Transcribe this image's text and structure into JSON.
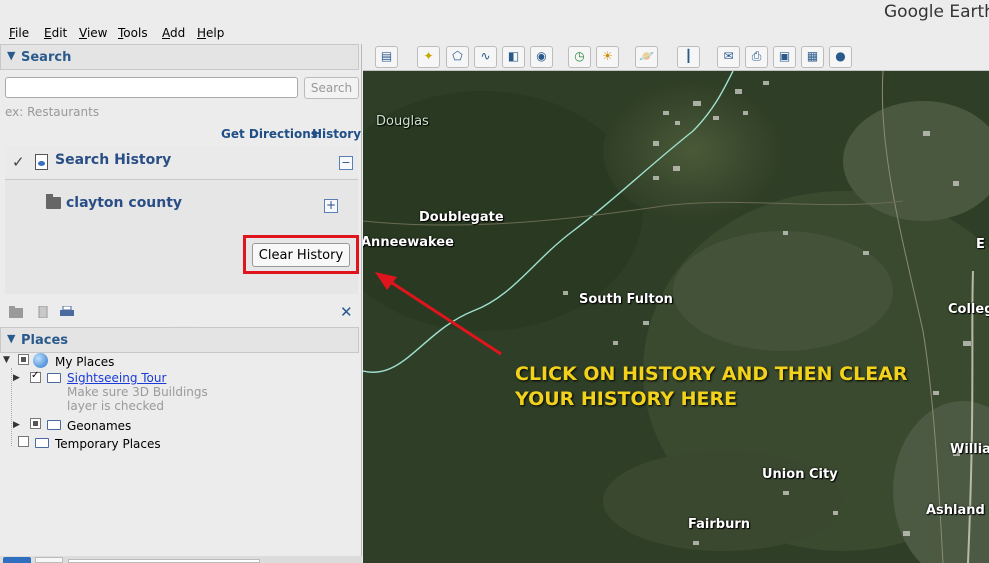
{
  "app_title": "Google Earth",
  "menu": {
    "items": [
      {
        "key": "F",
        "rest": "ile"
      },
      {
        "key": "E",
        "rest": "dit"
      },
      {
        "key": "V",
        "rest": "iew"
      },
      {
        "key": "T",
        "rest": "ools"
      },
      {
        "key": "A",
        "rest": "dd"
      },
      {
        "key": "H",
        "rest": "elp"
      }
    ]
  },
  "search_panel": {
    "header": "Search",
    "input_value": "",
    "button_label": "Search",
    "hint": "ex: Restaurants",
    "get_directions": "Get Directions",
    "history_link": "History",
    "history_title": "Search History",
    "history_item": "clayton county",
    "clear_history": "Clear History"
  },
  "places_panel": {
    "header": "Places",
    "my_places": "My Places",
    "sightseeing_tour": "Sightseeing Tour",
    "note_line1": "Make sure 3D Buildings",
    "note_line2": "layer is checked",
    "geonames": "Geonames",
    "temporary_places": "Temporary Places"
  },
  "toolbar_icons": [
    "sidebar-toggle-icon",
    "placemark-icon",
    "polygon-icon",
    "path-icon",
    "image-overlay-icon",
    "record-tour-icon",
    "historical-imagery-icon",
    "sunlight-icon",
    "planets-icon",
    "ruler-icon",
    "email-icon",
    "print-icon",
    "save-image-icon",
    "google-maps-icon",
    "earth-gallery-icon"
  ],
  "map": {
    "labels": [
      "Douglas",
      "Doublegate",
      "Anneewakee",
      "South Fulton",
      "Union City",
      "Fairburn",
      "E",
      "Colleg",
      "Willian",
      "Ashland P"
    ],
    "annotation_line1": "CLICK ON HISTORY AND THEN CLEAR",
    "annotation_line2": "YOUR HISTORY HERE"
  },
  "colors": {
    "annotation_text": "#f2d21a",
    "highlight_box": "#e0141c",
    "link_blue": "#1f4f86"
  }
}
